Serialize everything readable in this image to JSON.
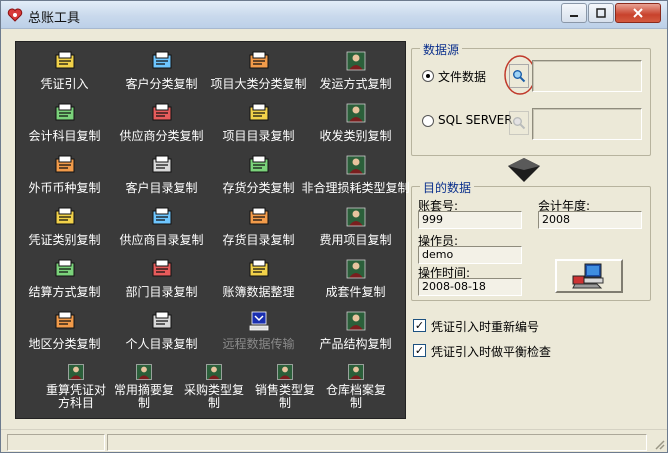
{
  "window": {
    "title": "总账工具"
  },
  "tools": [
    {
      "label": "凭证引入",
      "icon": "voucher-import-icon"
    },
    {
      "label": "客户分类复制",
      "icon": "customer-category-icon"
    },
    {
      "label": "项目大类分类复制",
      "icon": "project-class-icon"
    },
    {
      "label": "发运方式复制",
      "icon": "shipping-method-icon"
    },
    {
      "label": "会计科目复制",
      "icon": "account-subject-icon"
    },
    {
      "label": "供应商分类复制",
      "icon": "supplier-category-icon"
    },
    {
      "label": "项目目录复制",
      "icon": "project-catalog-icon"
    },
    {
      "label": "收发类别复制",
      "icon": "receive-dispatch-icon"
    },
    {
      "label": "外币币种复制",
      "icon": "currency-icon"
    },
    {
      "label": "客户目录复制",
      "icon": "customer-catalog-icon"
    },
    {
      "label": "存货分类复制",
      "icon": "inventory-category-icon"
    },
    {
      "label": "非合理损耗类型复制",
      "icon": "loss-type-icon"
    },
    {
      "label": "凭证类别复制",
      "icon": "voucher-type-icon"
    },
    {
      "label": "供应商目录复制",
      "icon": "supplier-catalog-icon"
    },
    {
      "label": "存货目录复制",
      "icon": "inventory-catalog-icon"
    },
    {
      "label": "费用项目复制",
      "icon": "expense-item-icon"
    },
    {
      "label": "结算方式复制",
      "icon": "settlement-method-icon"
    },
    {
      "label": "部门目录复制",
      "icon": "department-catalog-icon"
    },
    {
      "label": "账簿数据整理",
      "icon": "ledger-data-icon"
    },
    {
      "label": "成套件复制",
      "icon": "kit-icon"
    },
    {
      "label": "地区分类复制",
      "icon": "region-category-icon"
    },
    {
      "label": "个人目录复制",
      "icon": "personal-catalog-icon"
    },
    {
      "label": "远程数据传输",
      "icon": "remote-transfer-icon",
      "disabled": true
    },
    {
      "label": "产品结构复制",
      "icon": "product-structure-icon"
    },
    {
      "label": "重算凭证对方科目",
      "icon": "recalc-voucher-icon"
    },
    {
      "label": "常用摘要复制",
      "icon": "common-summary-icon"
    },
    {
      "label": "采购类型复制",
      "icon": "purchase-type-icon"
    },
    {
      "label": "销售类型复制",
      "icon": "sales-type-icon"
    },
    {
      "label": "仓库档案复制",
      "icon": "warehouse-icon"
    }
  ],
  "source": {
    "group_label": "数据源",
    "file_label": "文件数据",
    "sql_label": "SQL SERVER",
    "file_selected": true,
    "file_path": "",
    "sql_path": ""
  },
  "target": {
    "group_label": "目的数据",
    "account_set_label": "账套号:",
    "account_set_value": "999",
    "fiscal_year_label": "会计年度:",
    "fiscal_year_value": "2008",
    "operator_label": "操作员:",
    "operator_value": "demo",
    "op_time_label": "操作时间:",
    "op_time_value": "2008-08-18"
  },
  "options": [
    {
      "label": "凭证引入时重新编号",
      "checked": true
    },
    {
      "label": "凭证引入时做平衡检查",
      "checked": true
    }
  ],
  "colors": {
    "panel_bg": "#3a3a3a",
    "group_title": "#0a2f8c",
    "window_bg": "#ece9d8"
  }
}
